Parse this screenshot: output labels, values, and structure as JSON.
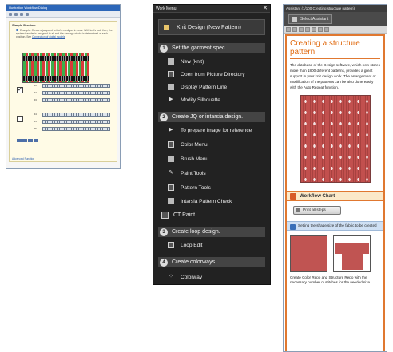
{
  "left_window": {
    "title": "Illustration Workflow Dialog",
    "header": "Simple Preview",
    "description": "Example: Create a jacquard knit of a cardigan in rows. With knit's look then, the system transfer is assigned to all and the carriage stroke is determined at each position. See",
    "description_link": "Connection of digital models",
    "row_labels": [
      "R1",
      "R2",
      "R3",
      "R4",
      "R5",
      "R6"
    ],
    "checked_mark": "✓",
    "footer_link": "Advanced Function"
  },
  "work_menu": {
    "title": "Work Menu",
    "close": "✕",
    "pattern_button": "Knit Design (New Pattern)",
    "sections": [
      {
        "number": "1",
        "title": "Set the garment spec.",
        "items": [
          {
            "label": "New (knit)",
            "icon": "knit-icon"
          },
          {
            "label": "Open from Picture Directory",
            "icon": "folder-icon"
          },
          {
            "label": "Display Pattern Line",
            "icon": "pattern-line-icon"
          },
          {
            "label": "Modify Silhouette",
            "icon": "arrow-icon"
          }
        ]
      },
      {
        "number": "2",
        "title": "Create JQ or intarsia design.",
        "items": [
          {
            "label": "To prepare image for reference",
            "icon": "arrow-icon"
          },
          {
            "label": "Color Menu",
            "icon": "color-icon"
          },
          {
            "label": "Brush Menu",
            "icon": "brush-icon"
          },
          {
            "label": "Paint Tools",
            "icon": "paint-icon"
          },
          {
            "label": "Pattern Tools",
            "icon": "pattern-tools-icon"
          },
          {
            "label": "Intarsia Pattern Check",
            "icon": "check-icon"
          }
        ]
      }
    ],
    "ct_paint": "CT Paint",
    "section3": {
      "number": "3",
      "title": "Create loop design.",
      "items": [
        {
          "label": "Loop Edit",
          "icon": "loop-icon"
        }
      ]
    },
    "section4": {
      "number": "4",
      "title": "Create colorways.",
      "items": [
        {
          "label": "Colorway",
          "icon": "colorway-icon"
        }
      ]
    }
  },
  "right_window": {
    "title": "Assistant (1/100 Creating structure pattern)",
    "select_button": "Select Assistant",
    "heading": "Creating a structure pattern",
    "body": "The database of the Design software, which now stores more than 1800 different patterns, provides a great support in your knit design work. The arrangement or modification of the patterns can be also done easily with the Auto Repeat function.",
    "workflow_title": "Workflow Chart",
    "print_button": "Print all steps",
    "step_text": "Setting the shape/size of the fabric to be created",
    "caption": "Create Color Repo and Structure Repo with the necessary number of stitches for the needed size"
  }
}
